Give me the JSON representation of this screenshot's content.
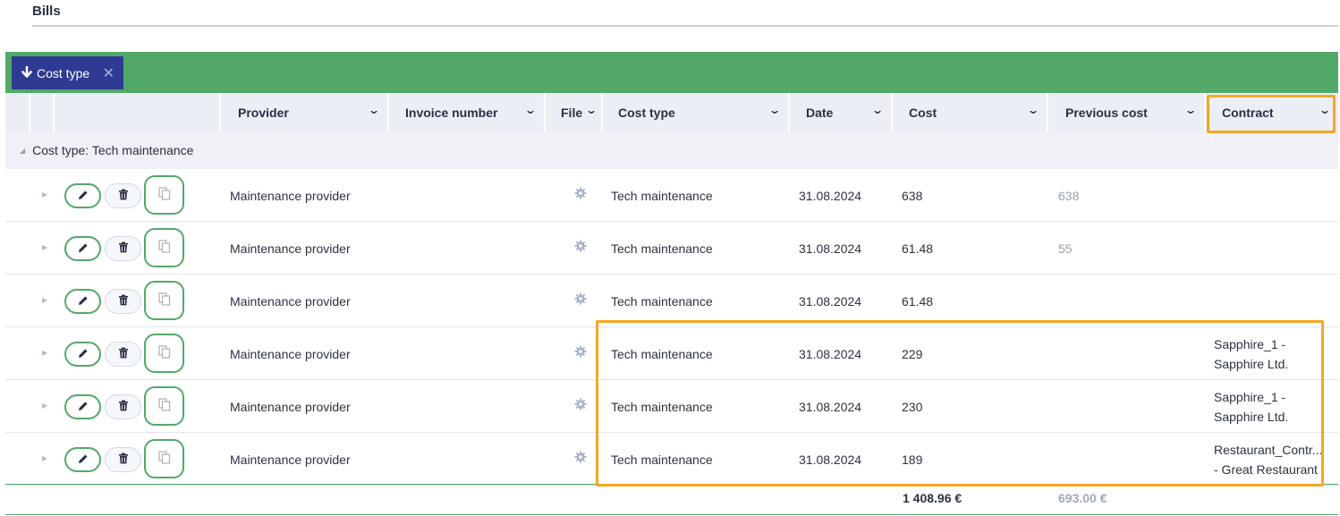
{
  "page": {
    "title": "Bills"
  },
  "grouping": {
    "chip_label": "Cost type",
    "remove_glyph": "✕",
    "arrow_glyph": "🡓"
  },
  "columns": {
    "provider": "Provider",
    "invoice_number": "Invoice number",
    "file": "File",
    "cost_type": "Cost type",
    "date": "Date",
    "cost": "Cost",
    "previous_cost": "Previous cost",
    "contract": "Contract"
  },
  "group": {
    "label": "Cost type: Tech maintenance"
  },
  "rows": [
    {
      "provider": "Maintenance provider",
      "invoice_number": "",
      "cost_type": "Tech maintenance",
      "date": "31.08.2024",
      "cost": "638",
      "previous_cost": "638",
      "contract_line1": "",
      "contract_line2": ""
    },
    {
      "provider": "Maintenance provider",
      "invoice_number": "",
      "cost_type": "Tech maintenance",
      "date": "31.08.2024",
      "cost": "61.48",
      "previous_cost": "55",
      "contract_line1": "",
      "contract_line2": ""
    },
    {
      "provider": "Maintenance provider",
      "invoice_number": "",
      "cost_type": "Tech maintenance",
      "date": "31.08.2024",
      "cost": "61.48",
      "previous_cost": "",
      "contract_line1": "",
      "contract_line2": ""
    },
    {
      "provider": "Maintenance provider",
      "invoice_number": "",
      "cost_type": "Tech maintenance",
      "date": "31.08.2024",
      "cost": "229",
      "previous_cost": "",
      "contract_line1": "Sapphire_1 -",
      "contract_line2": "Sapphire Ltd."
    },
    {
      "provider": "Maintenance provider",
      "invoice_number": "",
      "cost_type": "Tech maintenance",
      "date": "31.08.2024",
      "cost": "230",
      "previous_cost": "",
      "contract_line1": "Sapphire_1 -",
      "contract_line2": "Sapphire Ltd."
    },
    {
      "provider": "Maintenance provider",
      "invoice_number": "",
      "cost_type": "Tech maintenance",
      "date": "31.08.2024",
      "cost": "189",
      "previous_cost": "",
      "contract_line1": "Restaurant_Contr...",
      "contract_line2": "- Great Restaurant"
    }
  ],
  "totals": {
    "cost": "1 408.96 €",
    "previous_cost": "693.00 €"
  },
  "colors": {
    "accent_green": "#52a96a",
    "chip_blue": "#2f3a92",
    "highlight": "#f2a825"
  },
  "icons": {
    "edit": "pencil-icon",
    "delete": "trash-icon",
    "copy": "copy-icon",
    "file": "gear-icon",
    "sort": "chevron-down-icon",
    "expand": "triangle-right-icon"
  }
}
